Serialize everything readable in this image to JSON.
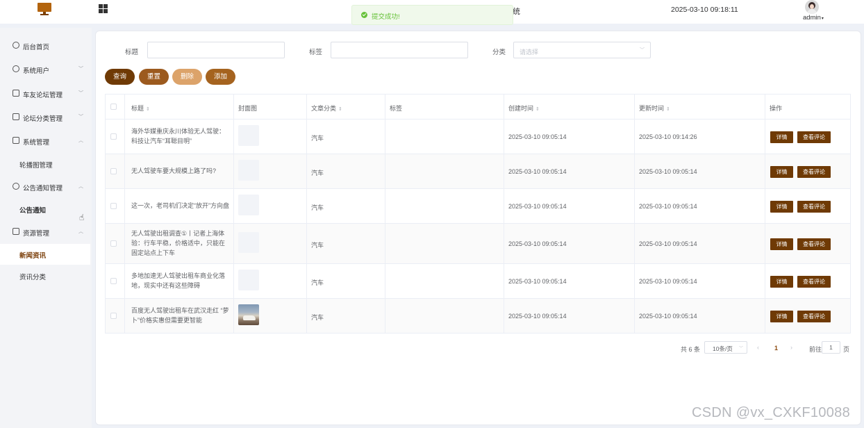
{
  "header": {
    "system_title": "统",
    "datetime": "2025-03-10 09:18:11",
    "username": "admin",
    "apps_icon": "grid-icon",
    "brand_color": "#b3640e"
  },
  "toast": {
    "message": "提交成功!",
    "color": "#67c23a"
  },
  "sidebar": {
    "items": [
      {
        "label": "后台首页",
        "icon": "dashboard-icon"
      },
      {
        "label": "系统用户",
        "icon": "user-icon",
        "expanded": false
      },
      {
        "label": "车友论坛管理",
        "icon": "forum-icon",
        "expanded": false
      },
      {
        "label": "论坛分类管理",
        "icon": "category-icon",
        "expanded": false
      },
      {
        "label": "系统管理",
        "icon": "folder-icon",
        "expanded": true
      },
      {
        "label": "公告通知管理",
        "icon": "notice-icon",
        "expanded": true
      },
      {
        "label": "资源管理",
        "icon": "resource-icon",
        "expanded": true
      }
    ],
    "sub_items": [
      {
        "label": "轮播图管理"
      },
      {
        "label": "公告通知"
      },
      {
        "label": "新闻资讯",
        "active": true
      },
      {
        "label": "资讯分类"
      }
    ]
  },
  "filters": {
    "title_label": "标题",
    "title_value": "",
    "tag_label": "标签",
    "tag_value": "",
    "category_label": "分类",
    "category_placeholder": "请选择"
  },
  "actions": {
    "query": "查询",
    "reset": "重置",
    "delete": "删除",
    "add": "添加",
    "colors": {
      "query": "#6f3a05",
      "reset": "#9c5a1e",
      "delete": "#dca36a",
      "add": "#a5631f"
    }
  },
  "table": {
    "columns": [
      "标题",
      "封面图",
      "文章分类",
      "标签",
      "创建时间",
      "更新时间",
      "操作"
    ],
    "rows": [
      {
        "title": "海外华媒重庆永川体验无人驾驶：科技让汽车“耳聪目明”",
        "cover": false,
        "category": "汽车",
        "tag": "",
        "created": "2025-03-10 09:05:14",
        "updated": "2025-03-10 09:14:26"
      },
      {
        "title": "无人驾驶车要大规模上路了吗?",
        "cover": false,
        "category": "汽车",
        "tag": "",
        "created": "2025-03-10 09:05:14",
        "updated": "2025-03-10 09:05:14"
      },
      {
        "title": "这一次，老司机们决定“放开”方向盘",
        "cover": false,
        "category": "汽车",
        "tag": "",
        "created": "2025-03-10 09:05:14",
        "updated": "2025-03-10 09:05:14"
      },
      {
        "title": "无人驾驶出租调查①丨记者上海体验：行车平稳，价格适中，只能在固定站点上下车",
        "cover": false,
        "category": "汽车",
        "tag": "",
        "created": "2025-03-10 09:05:14",
        "updated": "2025-03-10 09:05:14"
      },
      {
        "title": "多地加速无人驾驶出租车商业化落地，现实中还有这些障碍",
        "cover": false,
        "category": "汽车",
        "tag": "",
        "created": "2025-03-10 09:05:14",
        "updated": "2025-03-10 09:05:14"
      },
      {
        "title": "百度无人驾驶出租车在武汉走红 “萝卜”价格实惠但需要更智能",
        "cover": true,
        "category": "汽车",
        "tag": "",
        "created": "2025-03-10 09:05:14",
        "updated": "2025-03-10 09:05:14"
      }
    ],
    "detail_label": "详情",
    "comments_label": "查看评论"
  },
  "pagination": {
    "total_text": "共 6 条",
    "page_size": "10条/页",
    "current_page": "1",
    "goto_label": "前往",
    "goto_value": "1",
    "unit": "页"
  },
  "watermark": "CSDN @vx_CXKF10088"
}
